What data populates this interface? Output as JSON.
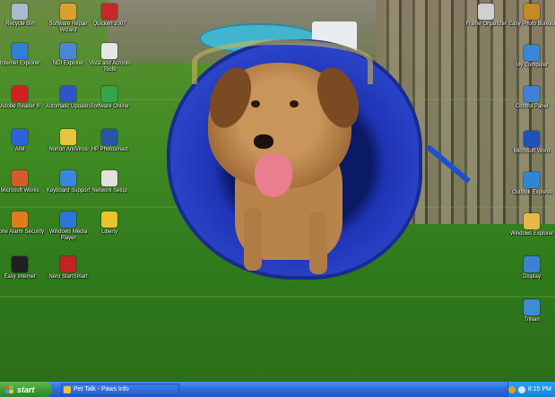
{
  "desktop_icons": [
    {
      "label": "Recycle Bin",
      "icon": "recycle-bin-icon",
      "color": "#a9bccf"
    },
    {
      "label": "Software Repair Wizard",
      "icon": "repair-wizard-icon",
      "color": "#d9a030"
    },
    {
      "label": "Quicken 2007",
      "icon": "quicken-icon",
      "color": "#c72727"
    },
    {
      "label": "Internet Explorer",
      "icon": "internet-explorer-icon",
      "color": "#2f7fd6"
    },
    {
      "label": "NDI Explorer",
      "icon": "ndi-explorer-icon",
      "color": "#4a86d8"
    },
    {
      "label": "Vista and Acronis Tools",
      "icon": "tools-icon",
      "color": "#e6e6e6"
    },
    {
      "label": "Adobe Reader 8",
      "icon": "adobe-reader-icon",
      "color": "#d02020"
    },
    {
      "label": "Automatic Updates",
      "icon": "updates-icon",
      "color": "#2d55c7"
    },
    {
      "label": "Software Online",
      "icon": "software-online-icon",
      "color": "#33a64a"
    },
    {
      "label": "AIM",
      "icon": "aim-icon",
      "color": "#2c63d8"
    },
    {
      "label": "Norton AntiVirus",
      "icon": "norton-icon",
      "color": "#e7c53a"
    },
    {
      "label": "HP Photosmart",
      "icon": "hp-photosmart-icon",
      "color": "#2656a8"
    },
    {
      "label": "Microsoft Works",
      "icon": "works-icon",
      "color": "#d85a2a"
    },
    {
      "label": "Keyboard Support",
      "icon": "keyboard-support-icon",
      "color": "#3a86e0"
    },
    {
      "label": "Network Setup",
      "icon": "network-setup-icon",
      "color": "#e0e0e0"
    },
    {
      "label": "Zone Alarm Security",
      "icon": "zone-alarm-icon",
      "color": "#e27a20"
    },
    {
      "label": "Windows Media Player",
      "icon": "media-player-icon",
      "color": "#2b76d6"
    },
    {
      "label": "Liberty",
      "icon": "liberty-icon",
      "color": "#e8c52a"
    },
    {
      "label": "Easy Internet",
      "icon": "easy-internet-icon",
      "color": "#202020"
    },
    {
      "label": "Nero StartSmart",
      "icon": "nero-icon",
      "color": "#c62222"
    },
    {
      "label": "Frame Organizer",
      "icon": "frame-organizer-icon",
      "color": "#d0d0d0"
    },
    {
      "label": "Easy Photo Bureau",
      "icon": "photo-bureau-icon",
      "color": "#c48a24"
    },
    {
      "label": "My Computer",
      "icon": "my-computer-icon",
      "color": "#3a86d8"
    },
    {
      "label": "Control Panel",
      "icon": "control-panel-icon",
      "color": "#3f7fd6"
    },
    {
      "label": "Microsoft Word",
      "icon": "word-icon",
      "color": "#2050b8"
    },
    {
      "label": "Outlook Express",
      "icon": "outlook-icon",
      "color": "#2f86d8"
    },
    {
      "label": "Windows Explorer",
      "icon": "windows-explorer-icon",
      "color": "#e6b84a"
    },
    {
      "label": "Display",
      "icon": "display-icon",
      "color": "#3b82d6"
    },
    {
      "label": "Trillian",
      "icon": "trillian-icon",
      "color": "#3e8bd6"
    }
  ],
  "taskbar": {
    "start_label": "start",
    "task_label": "Pet Talk - Paws Info",
    "clock": "8:15 PM"
  }
}
